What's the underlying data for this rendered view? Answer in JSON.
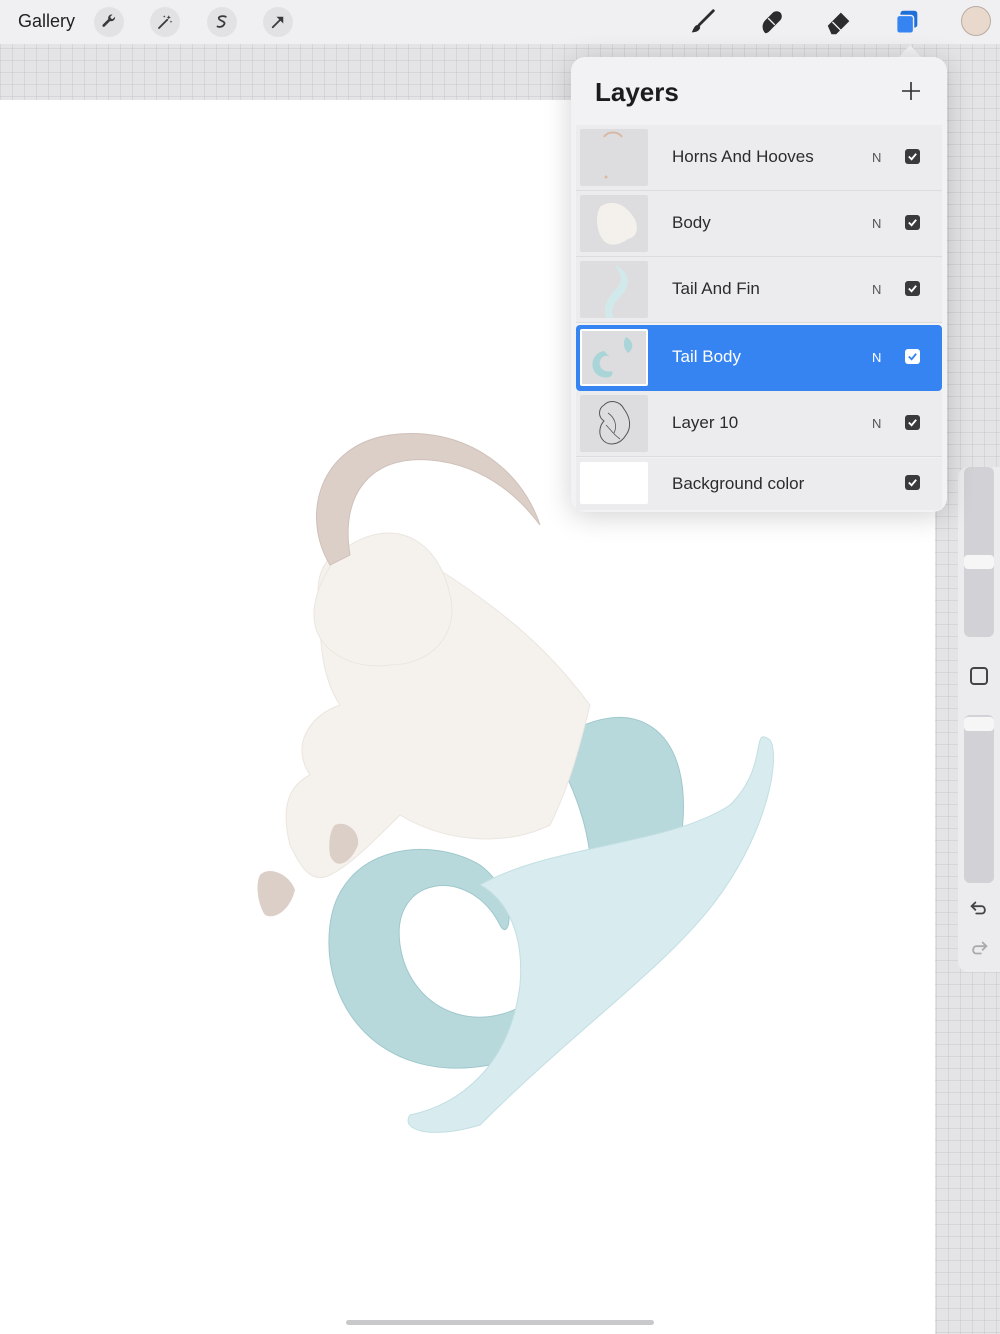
{
  "toolbar": {
    "gallery_label": "Gallery",
    "left_tools": [
      "wrench-icon",
      "magic-wand-icon",
      "selection-icon",
      "transform-arrow-icon"
    ],
    "right_tools": [
      "brush-icon",
      "smudge-icon",
      "eraser-icon",
      "layers-icon"
    ],
    "active_tool": "layers-icon",
    "current_color": "#e9d8cc",
    "accent_color": "#3584f2"
  },
  "layers_panel": {
    "title": "Layers",
    "add_icon": "plus-icon",
    "layers": [
      {
        "name": "Horns And Hooves",
        "blend": "N",
        "visible": true,
        "selected": false
      },
      {
        "name": "Body",
        "blend": "N",
        "visible": true,
        "selected": false
      },
      {
        "name": "Tail And Fin",
        "blend": "N",
        "visible": true,
        "selected": false
      },
      {
        "name": "Tail Body",
        "blend": "N",
        "visible": true,
        "selected": true
      },
      {
        "name": "Layer 10",
        "blend": "N",
        "visible": true,
        "selected": false
      }
    ],
    "background": {
      "name": "Background color",
      "visible": true
    }
  },
  "sidebar": {
    "undo_icon": "undo-icon",
    "redo_icon": "redo-icon",
    "modify_icon": "square-icon"
  }
}
